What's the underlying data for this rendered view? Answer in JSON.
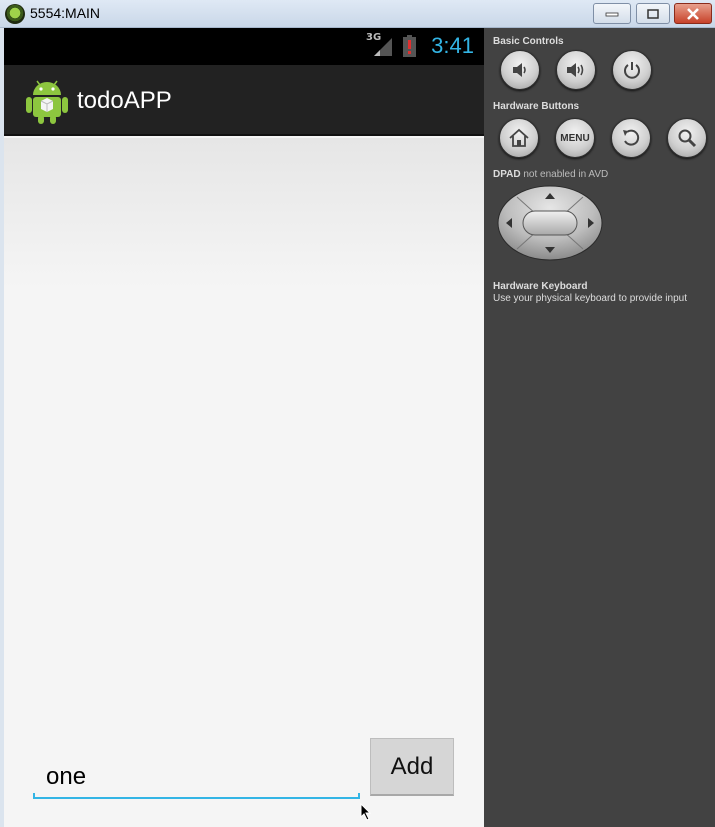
{
  "window": {
    "title": "5554:MAIN"
  },
  "status_bar": {
    "network": "3G",
    "time": "3:41",
    "time_color": "#33b5e5"
  },
  "app": {
    "title": "todoAPP",
    "input_value": "one",
    "add_button_label": "Add",
    "accent": "#33b5e5"
  },
  "controls": {
    "basic_controls_label": "Basic Controls",
    "hardware_buttons_label": "Hardware Buttons",
    "menu_label": "MENU",
    "dpad_label": "DPAD",
    "dpad_note": "not enabled in AVD",
    "keyboard_label": "Hardware Keyboard",
    "keyboard_note": "Use your physical keyboard to provide input"
  },
  "icons": {
    "basic": [
      "volume-down-icon",
      "volume-up-icon",
      "power-icon"
    ],
    "hardware": [
      "home-icon",
      "menu-button",
      "back-icon",
      "search-icon"
    ]
  }
}
